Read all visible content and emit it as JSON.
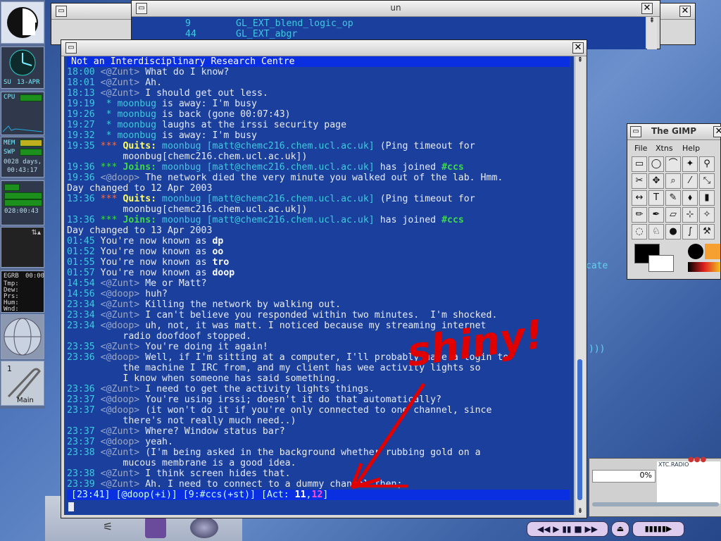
{
  "back_window": {
    "title": "un",
    "lines": [
      {
        "num": "9",
        "text": "GL_EXT_blend_logic_op"
      },
      {
        "num": "44",
        "text": "GL_EXT_abgr"
      }
    ]
  },
  "dock": {
    "date_day": "SU",
    "date_text": "13-APR",
    "cpu_label": "CPU",
    "mem_label": "MEM",
    "swp_label": "SWP",
    "uptime_days": "0028 days,",
    "uptime_time": "00:43:17",
    "clock2": "028:00:43",
    "weather_code": "EGRB",
    "weather_time": "00:00",
    "weather_labels": [
      "Tmp:",
      "Dew:",
      "Prs:",
      "Hum:",
      "Wnd:"
    ],
    "workspace_num": "1",
    "workspace_name": "Main"
  },
  "irssi": {
    "topic": "Not an Interdisciplinary Research Centre",
    "status_line": {
      "time": "[23:41]",
      "nick": "[@doop(+i)]",
      "channel": "[9:#ccs(+st)]",
      "act_prefix": "[Act: ",
      "act1": "11",
      "act_sep": ",",
      "act2": "12",
      "act_suffix": "]"
    },
    "lines": [
      {
        "ts": "18:00",
        "nick": "<@Zunt>",
        "msg": "What do I know?"
      },
      {
        "ts": "18:01",
        "nick": "<@Zunt>",
        "msg": "Ah."
      },
      {
        "ts": "18:13",
        "nick": "<@Zunt>",
        "msg": "I should get out less."
      },
      {
        "ts": "19:19",
        "action": " * moonbug",
        "msg": "is away: I'm busy"
      },
      {
        "ts": "19:26",
        "action": " * moonbug",
        "msg": "is back (gone 00:07:43)"
      },
      {
        "ts": "19:27",
        "action": " * moonbug",
        "msg": "laughs at the irssi security page"
      },
      {
        "ts": "19:32",
        "action": " * moonbug",
        "msg": "is away: I'm busy"
      },
      {
        "ts": "19:35",
        "quit": "***",
        "kind": "Quits:",
        "who": "moonbug",
        "host": "[matt@chemc216.chem.ucl.ac.uk]",
        "msg": "(Ping timeout for"
      },
      {
        "ts": "",
        "cont": "moonbug[chemc216.chem.ucl.ac.uk])"
      },
      {
        "ts": "19:36",
        "join": "***",
        "kind": "Joins:",
        "who": "moonbug",
        "host": "[matt@chemc216.chem.ucl.ac.uk]",
        "msg": "has joined",
        "chan": "#ccs"
      },
      {
        "ts": "19:36",
        "nick": "<@doop>",
        "self": true,
        "msg": "The network died the very minute you walked out of the lab. Hmm."
      },
      {
        "ts": "",
        "day": "Day changed to 12 Apr 2003"
      },
      {
        "ts": "13:36",
        "quit": "***",
        "kind": "Quits:",
        "who": "moonbug",
        "host": "[matt@chemc216.chem.ucl.ac.uk]",
        "msg": "(Ping timeout for"
      },
      {
        "ts": "",
        "cont": "moonbug[chemc216.chem.ucl.ac.uk])"
      },
      {
        "ts": "13:36",
        "join": "***",
        "kind": "Joins:",
        "who": "moonbug",
        "host": "[matt@chemc216.chem.ucl.ac.uk]",
        "msg": "has joined",
        "chan": "#ccs"
      },
      {
        "ts": "",
        "day": "Day changed to 13 Apr 2003"
      },
      {
        "ts": "01:45",
        "known": "You're now known as",
        "newnick": "dp"
      },
      {
        "ts": "01:52",
        "known": "You're now known as",
        "newnick": "oo"
      },
      {
        "ts": "01:55",
        "known": "You're now known as",
        "newnick": "tro"
      },
      {
        "ts": "01:57",
        "known": "You're now known as",
        "newnick": "doop"
      },
      {
        "ts": "14:54",
        "nick": "<@Zunt>",
        "msg": "Me or Matt?"
      },
      {
        "ts": "14:56",
        "nick": "<@doop>",
        "self": true,
        "msg": "huh?"
      },
      {
        "ts": "23:34",
        "nick": "<@Zunt>",
        "msg": "Killing the network by walking out."
      },
      {
        "ts": "23:34",
        "nick": "<@Zunt>",
        "msg": "I can't believe you responded within two minutes.  I'm shocked."
      },
      {
        "ts": "23:34",
        "nick": "<@doop>",
        "self": true,
        "msg": "uh, not, it was matt. I noticed because my streaming internet"
      },
      {
        "ts": "",
        "cont": "radio doofdoof stopped."
      },
      {
        "ts": "23:35",
        "nick": "<@Zunt>",
        "msg": "You're doing it again!"
      },
      {
        "ts": "23:36",
        "nick": "<@doop>",
        "self": true,
        "msg": "Well, if I'm sitting at a computer, I'll probably have a login to"
      },
      {
        "ts": "",
        "cont": "the machine I IRC from, and my client has wee activity lights so"
      },
      {
        "ts": "",
        "cont": "I know when someone has said something."
      },
      {
        "ts": "23:36",
        "nick": "<@Zunt>",
        "msg": "I need to get the activity lights things."
      },
      {
        "ts": "23:37",
        "nick": "<@doop>",
        "self": true,
        "msg": "You're using irssi; doesn't it do that automatically?"
      },
      {
        "ts": "23:37",
        "nick": "<@doop>",
        "self": true,
        "msg": "(it won't do it if you're only connected to one channel, since"
      },
      {
        "ts": "",
        "cont": "there's not really much need..)"
      },
      {
        "ts": "23:37",
        "nick": "<@Zunt>",
        "msg": "Where? Window status bar?"
      },
      {
        "ts": "23:37",
        "nick": "<@doop>",
        "self": true,
        "msg": "yeah."
      },
      {
        "ts": "23:38",
        "nick": "<@Zunt>",
        "msg": "(I'm being asked in the background whether rubbing gold on a"
      },
      {
        "ts": "",
        "cont": "mucous membrane is a good idea."
      },
      {
        "ts": "23:38",
        "nick": "<@Zunt>",
        "msg": "I think screen hides that."
      },
      {
        "ts": "23:39",
        "nick": "<@Zunt>",
        "msg": "Ah. I need to connect to a dummy channel then;"
      }
    ]
  },
  "gimp": {
    "title": "The GIMP",
    "menus": [
      "File",
      "Xtns",
      "Help"
    ],
    "tools": [
      "▭",
      "◯",
      "⌒",
      "✦",
      "⚲",
      "✂",
      "✥",
      "⌕",
      "⁄",
      "⤡",
      "↔",
      "T",
      "✎",
      "⬧",
      "▮",
      "✏",
      "✒",
      "▱",
      "⊹",
      "✧",
      "◌",
      "♘",
      "●",
      "∫",
      "⚒"
    ]
  },
  "background_text": {
    "cate": "cate",
    "parens": ")))",
    "percent": "0%",
    "radio_label": "XTC.RADIO"
  },
  "annotation": {
    "text": "shiny!",
    "color": "#e00000"
  }
}
